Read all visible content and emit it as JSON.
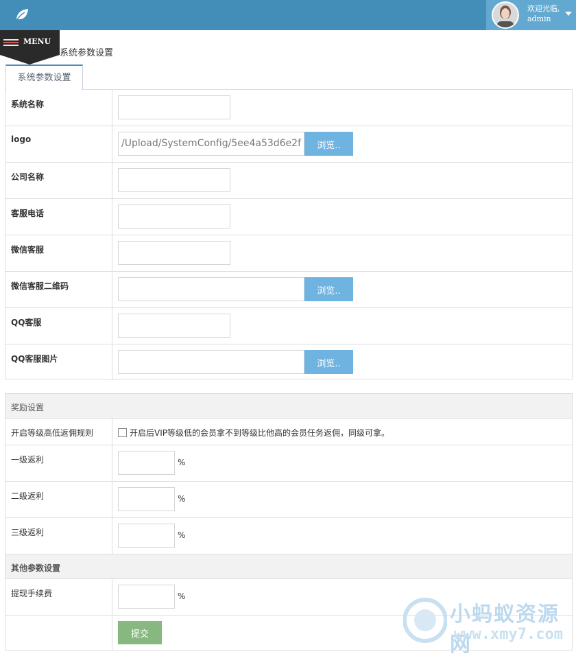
{
  "topbar": {
    "logo_icon": "leaf-icon",
    "user": {
      "welcome": "欢迎光临,",
      "name": "admin",
      "avatar_icon": "avatar-photo",
      "dropdown_icon": "caret-down-icon"
    }
  },
  "menu": {
    "label": "MENU",
    "icon": "hamburger-icon"
  },
  "page": {
    "title": "系统参数设置",
    "tab_label": "系统参数设置"
  },
  "system_form": {
    "rows": [
      {
        "label": "系统名称",
        "value": ""
      },
      {
        "label": "logo",
        "value": "/Upload/SystemConfig/5ee4a53d6e2f",
        "browse": "浏览.."
      },
      {
        "label": "公司名称",
        "value": ""
      },
      {
        "label": "客服电话",
        "value": ""
      },
      {
        "label": "微信客服",
        "value": ""
      },
      {
        "label": "微信客服二维码",
        "value": "",
        "browse": "浏览.."
      },
      {
        "label": "QQ客服",
        "value": ""
      },
      {
        "label": "QQ客服图片",
        "value": "",
        "browse": "浏览.."
      }
    ]
  },
  "reward": {
    "heading": "奖励设置",
    "level_rule": {
      "label": "开启等级高低返佣规则",
      "checkbox_text": "开启后VIP等级低的会员拿不到等级比他高的会员任务返佣，同级可拿。",
      "checked": false
    },
    "levels": [
      {
        "label": "一级返利",
        "value": "",
        "unit": "%"
      },
      {
        "label": "二级返利",
        "value": "",
        "unit": "%"
      },
      {
        "label": "三级返利",
        "value": "",
        "unit": "%"
      }
    ]
  },
  "other": {
    "heading": "其他参数设置",
    "fee": {
      "label": "提现手续费",
      "value": "",
      "unit": "%"
    },
    "submit": "提交"
  },
  "watermark": {
    "line1": "小蚂蚁资源网",
    "line2": "www.xmy7.com"
  },
  "colors": {
    "topbar": "#438eb9",
    "user_box": "#62a8d1",
    "browse_button": "#6fb3e0",
    "submit_button": "#87b87f"
  }
}
